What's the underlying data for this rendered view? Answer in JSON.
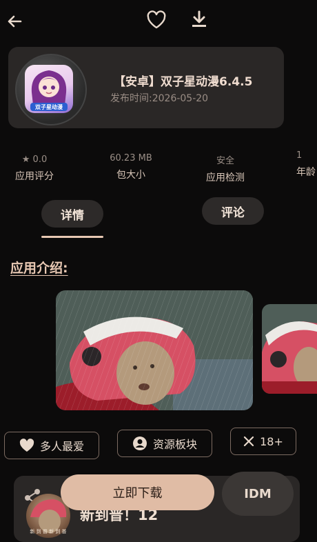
{
  "header": {
    "back_icon": "arrow-left-icon",
    "favorite_icon": "heart-outline-icon",
    "download_icon": "download-icon"
  },
  "app": {
    "title": "【安卓】双子星动漫6.4.5",
    "date": "发布时间:2026-05-20",
    "icon_caption": "双子星动漫"
  },
  "stats": [
    {
      "value": "0.0",
      "label": "应用评分"
    },
    {
      "value": "60.23 MB",
      "label": "包大小"
    },
    {
      "value": "安全",
      "label": "应用检测"
    },
    {
      "value": "1",
      "label": "年龄"
    }
  ],
  "tabs": [
    {
      "label": "详情"
    },
    {
      "label": "评论"
    }
  ],
  "section": {
    "title": "应用介绍:"
  },
  "chips": [
    {
      "icon": "heart-icon",
      "label": "多人最爱"
    },
    {
      "icon": "user-circle-icon",
      "label": "资源板块"
    },
    {
      "icon": "close-icon",
      "label": "18+"
    }
  ],
  "bottom": {
    "download_label": "立即下载",
    "idm_label": "IDM",
    "share_icon": "share-icon",
    "new_text": "新到普！12",
    "avatar_caption": "新 到 普 新 到 普"
  },
  "colors": {
    "background": "#0c0b0b",
    "card": "#2a2726",
    "accent": "#e0bca5"
  }
}
